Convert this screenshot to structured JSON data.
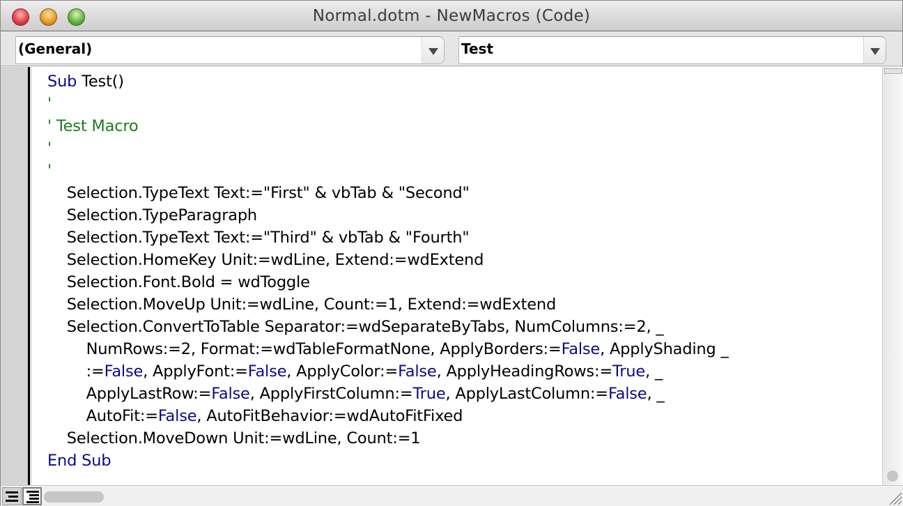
{
  "window": {
    "title": "Normal.dotm - NewMacros (Code)"
  },
  "toolbar": {
    "object_combo": {
      "value": "(General)"
    },
    "procedure_combo": {
      "value": "Test"
    }
  },
  "colors": {
    "keyword": "#0b0b84",
    "comment": "#1b7d1b",
    "text": "#000000"
  },
  "code": {
    "lines": [
      [
        {
          "t": "Sub",
          "c": "kw"
        },
        {
          "t": " Test()",
          "c": ""
        }
      ],
      [
        {
          "t": "'",
          "c": "cm"
        }
      ],
      [
        {
          "t": "' Test Macro",
          "c": "cm"
        }
      ],
      [
        {
          "t": "'",
          "c": "cm"
        }
      ],
      [
        {
          "t": "'",
          "c": "cm"
        }
      ],
      [
        {
          "t": "    Selection.TypeText Text:=\"First\" & vbTab & \"Second\"",
          "c": ""
        }
      ],
      [
        {
          "t": "    Selection.TypeParagraph",
          "c": ""
        }
      ],
      [
        {
          "t": "    Selection.TypeText Text:=\"Third\" & vbTab & \"Fourth\"",
          "c": ""
        }
      ],
      [
        {
          "t": "    Selection.HomeKey Unit:=wdLine, Extend:=wdExtend",
          "c": ""
        }
      ],
      [
        {
          "t": "    Selection.Font.Bold = wdToggle",
          "c": ""
        }
      ],
      [
        {
          "t": "    Selection.MoveUp Unit:=wdLine, Count:=1, Extend:=wdExtend",
          "c": ""
        }
      ],
      [
        {
          "t": "    Selection.ConvertToTable Separator:=wdSeparateByTabs, NumColumns:=2, _",
          "c": ""
        }
      ],
      [
        {
          "t": "        NumRows:=2, Format:=wdTableFormatNone, ApplyBorders:=",
          "c": ""
        },
        {
          "t": "False",
          "c": "kw"
        },
        {
          "t": ", ApplyShading _",
          "c": ""
        }
      ],
      [
        {
          "t": "        :=",
          "c": ""
        },
        {
          "t": "False",
          "c": "kw"
        },
        {
          "t": ", ApplyFont:=",
          "c": ""
        },
        {
          "t": "False",
          "c": "kw"
        },
        {
          "t": ", ApplyColor:=",
          "c": ""
        },
        {
          "t": "False",
          "c": "kw"
        },
        {
          "t": ", ApplyHeadingRows:=",
          "c": ""
        },
        {
          "t": "True",
          "c": "kw"
        },
        {
          "t": ", _",
          "c": ""
        }
      ],
      [
        {
          "t": "        ApplyLastRow:=",
          "c": ""
        },
        {
          "t": "False",
          "c": "kw"
        },
        {
          "t": ", ApplyFirstColumn:=",
          "c": ""
        },
        {
          "t": "True",
          "c": "kw"
        },
        {
          "t": ", ApplyLastColumn:=",
          "c": ""
        },
        {
          "t": "False",
          "c": "kw"
        },
        {
          "t": ", _",
          "c": ""
        }
      ],
      [
        {
          "t": "        AutoFit:=",
          "c": ""
        },
        {
          "t": "False",
          "c": "kw"
        },
        {
          "t": ", AutoFitBehavior:=wdAutoFitFixed",
          "c": ""
        }
      ],
      [
        {
          "t": "    Selection.MoveDown Unit:=wdLine, Count:=1",
          "c": ""
        }
      ],
      [
        {
          "t": "End Sub",
          "c": "kw"
        }
      ]
    ]
  },
  "bottombar": {
    "procedure_view_icon": "procedure-view-icon",
    "full_module_view_icon": "full-module-view-icon"
  }
}
